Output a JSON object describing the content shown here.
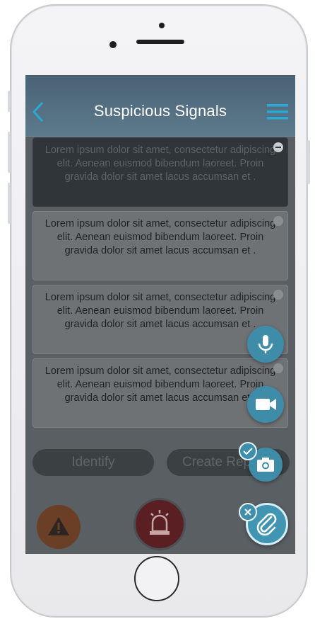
{
  "header": {
    "title": "Suspicious Signals"
  },
  "signals": [
    {
      "text": "Lorem ipsum dolor sit amet, consectetur adipiscing elit. Aenean euismod bibendum laoreet. Proin gravida dolor sit amet lacus accumsan et .",
      "selected": true
    },
    {
      "text": "Lorem ipsum dolor sit amet, consectetur adipiscing elit. Aenean euismod bibendum laoreet. Proin gravida dolor sit amet lacus accumsan et .",
      "selected": false
    },
    {
      "text": "Lorem ipsum dolor sit amet, consectetur adipiscing elit. Aenean euismod bibendum laoreet. Proin gravida dolor sit amet lacus accumsan et .",
      "selected": false
    },
    {
      "text": "Lorem ipsum dolor sit amet, consectetur adipiscing elit. Aenean euismod bibendum laoreet. Proin gravida dolor sit amet lacus accumsan et .",
      "selected": false
    }
  ],
  "actions": {
    "identify_label": "Identify",
    "create_report_label": "Create Report"
  },
  "icons": {
    "back": "chevron-left-icon",
    "menu": "hamburger-menu-icon",
    "alert": "warning-triangle-icon",
    "siren": "siren-icon",
    "mic": "microphone-icon",
    "video": "video-camera-icon",
    "camera": "camera-icon",
    "check": "check-icon",
    "close": "close-icon",
    "attach": "paperclip-icon"
  },
  "colors": {
    "accent": "#3e8ca8",
    "nav": "#4e6779",
    "alert": "#6a3f26",
    "siren": "#5a1f22"
  }
}
